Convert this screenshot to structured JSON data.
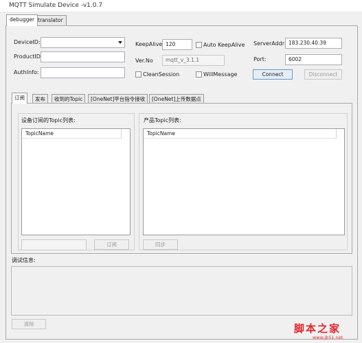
{
  "window": {
    "title": "MQTT Simulate Device  -v1.0.7"
  },
  "top_tabs": [
    "debugger",
    "translator"
  ],
  "connection": {
    "device_id_label": "DeviceID:",
    "device_id_value": "",
    "product_id_label": "ProductID:",
    "product_id_value": "",
    "auth_info_label": "AuthInfo:",
    "auth_info_value": "",
    "keepalive_label": "KeepAlive:",
    "keepalive_value": "120",
    "auto_keepalive_label": "Auto KeepAlive",
    "auto_keepalive_checked": false,
    "ver_label": "Ver.No",
    "ver_value": "mqtt_v_3.1.1",
    "clean_session_label": "CleanSession",
    "clean_session_checked": false,
    "will_message_label": "WillMessage",
    "will_message_checked": false,
    "server_addr_label": "ServerAddr:",
    "server_addr_value": "183.230.40.39",
    "port_label": "Port:",
    "port_value": "6002",
    "connect_label": "Connect",
    "disconnect_label": "Disconnect"
  },
  "inner_tabs": [
    "订阅",
    "发布",
    "收到的Topic",
    "[OneNet]平台指令接收",
    "[OneNet]上传数据点"
  ],
  "subscribe": {
    "left_title": "设备订阅的Topic列表:",
    "left_column": "TopicName",
    "right_title": "产品Topic列表:",
    "right_column": "TopicName",
    "subscribe_input_value": "",
    "subscribe_button": "订阅",
    "sync_button": "同步"
  },
  "debug": {
    "title": "调试信息:",
    "clear_button": "清除"
  },
  "watermark": {
    "text": "脚本之家",
    "url": "www.jb51.net"
  }
}
